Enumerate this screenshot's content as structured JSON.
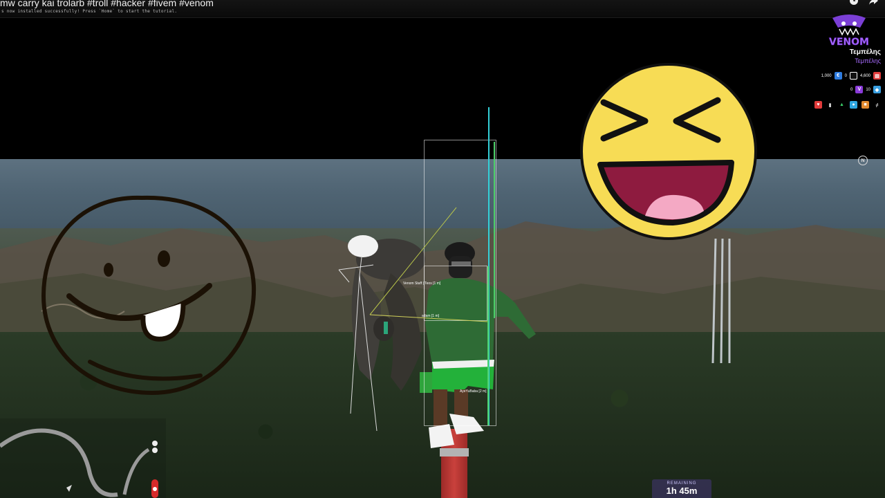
{
  "video": {
    "title": "mw carry kai trolarb #troll #hacker #fivem #venom",
    "notice": "s now installed successfully! Press `Home` to start the tutorial."
  },
  "hud": {
    "logo_text": "VENOM",
    "player_name": "Τεμπέλης",
    "player_sub": "Τεμπέλης",
    "money_row": [
      {
        "value": "1,000",
        "icon": "cash-icon",
        "color": "#2f7de1"
      },
      {
        "value": "0",
        "icon": "wallet-icon",
        "color": "#ffffff"
      },
      {
        "value": "4,600",
        "icon": "bank-icon",
        "color": "#e23b3b"
      }
    ],
    "vip_row": [
      {
        "value": "0",
        "icon": "v-coin-icon",
        "color": "#8a3ad9"
      },
      {
        "value": "10",
        "icon": "gem-icon",
        "color": "#3aa0e2"
      }
    ],
    "status_icons": [
      {
        "icon": "heart-icon",
        "color": "#e23b3b"
      },
      {
        "icon": "lock-icon",
        "color": "#cccccc"
      },
      {
        "icon": "armor-icon",
        "color": "#3bd16b"
      },
      {
        "icon": "water-icon",
        "color": "#2fa7e1"
      },
      {
        "icon": "food-icon",
        "color": "#e28a2f"
      },
      {
        "icon": "stamina-icon",
        "color": "#cccccc"
      }
    ],
    "compass": "N"
  },
  "esp": {
    "labels": [
      "Venom Staff | Teos [1 m]",
      "adam [1 m]",
      "AyeYuBaba [2 m]"
    ]
  },
  "timer": {
    "label": "REMAINING",
    "value": "1h 45m"
  },
  "colors": {
    "emoji_yellow": "#f7dc55",
    "emoji_mouth": "#8e1b3f",
    "emoji_tongue": "#f4a9c4",
    "esp_cyan": "#33d0d8",
    "esp_green": "#4fd16b",
    "venom_purple": "#a86bff"
  }
}
